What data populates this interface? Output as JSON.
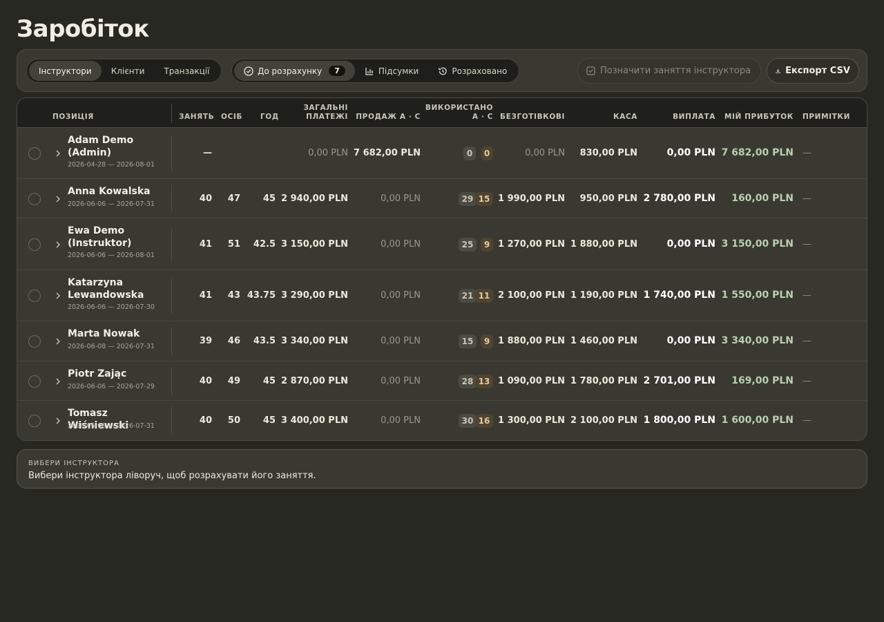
{
  "page_title": "Заробіток",
  "tabs_group1": [
    {
      "label": "Інструктори",
      "active": true
    },
    {
      "label": "Клієнти",
      "active": false
    },
    {
      "label": "Транзакції",
      "active": false
    }
  ],
  "tabs_group2": {
    "pending": {
      "label": "До розрахунку",
      "count": "7",
      "icon": "check-circle-icon"
    },
    "totals": {
      "label": "Підсумки",
      "icon": "bar-chart-icon"
    },
    "settled": {
      "label": "Розраховано",
      "icon": "history-icon"
    }
  },
  "actions": {
    "mark_label": "Позначити заняття інструктора",
    "export_label": "Експорт CSV"
  },
  "table": {
    "headers": {
      "position": "Позиція",
      "lessons": "Занять",
      "people": "Осіб",
      "hours": "Год",
      "total_payments_1": "Загальні",
      "total_payments_2": "платежі",
      "sales": "Продаж А · С",
      "used_1": "Використано",
      "used_2": "А · С",
      "cashless": "Безготівкові",
      "cash": "Каса",
      "payout": "Виплата",
      "profit": "Мій прибуток",
      "notes": "Примітки"
    },
    "rows": [
      {
        "name": "Adam Demo (Admin)",
        "dates": "2026-04-28 — 2026-08-01",
        "lessons": "—",
        "people": "",
        "hours": "",
        "payments": "0,00 PLN",
        "sales": "7 682,00 PLN",
        "used_a": "0",
        "used_c": "0",
        "cashless": "0,00 PLN",
        "cash": "830,00 PLN",
        "payout": "0,00 PLN",
        "profit": "7 682,00 PLN",
        "notes": "—"
      },
      {
        "name": "Anna Kowalska",
        "dates": "2026-06-06 — 2026-07-31",
        "lessons": "40",
        "people": "47",
        "hours": "45",
        "payments": "2 940,00 PLN",
        "sales": "0,00 PLN",
        "used_a": "29",
        "used_c": "15",
        "cashless": "1 990,00 PLN",
        "cash": "950,00 PLN",
        "payout": "2 780,00 PLN",
        "profit": "160,00 PLN",
        "notes": "—"
      },
      {
        "name": "Ewa Demo (Instruktor)",
        "dates": "2026-06-06 — 2026-08-01",
        "lessons": "41",
        "people": "51",
        "hours": "42.5",
        "payments": "3 150,00 PLN",
        "sales": "0,00 PLN",
        "used_a": "25",
        "used_c": "9",
        "cashless": "1 270,00 PLN",
        "cash": "1 880,00 PLN",
        "payout": "0,00 PLN",
        "profit": "3 150,00 PLN",
        "notes": "—"
      },
      {
        "name": "Katarzyna Lewandowska",
        "dates": "2026-06-06 — 2026-07-30",
        "lessons": "41",
        "people": "43",
        "hours": "43.75",
        "payments": "3 290,00 PLN",
        "sales": "0,00 PLN",
        "used_a": "21",
        "used_c": "11",
        "cashless": "2 100,00 PLN",
        "cash": "1 190,00 PLN",
        "payout": "1 740,00 PLN",
        "profit": "1 550,00 PLN",
        "notes": "—"
      },
      {
        "name": "Marta Nowak",
        "dates": "2026-06-08 — 2026-07-31",
        "lessons": "39",
        "people": "46",
        "hours": "43.5",
        "payments": "3 340,00 PLN",
        "sales": "0,00 PLN",
        "used_a": "15",
        "used_c": "9",
        "cashless": "1 880,00 PLN",
        "cash": "1 460,00 PLN",
        "payout": "0,00 PLN",
        "profit": "3 340,00 PLN",
        "notes": "—"
      },
      {
        "name": "Piotr Zając",
        "dates": "2026-06-06 — 2026-07-29",
        "lessons": "40",
        "people": "49",
        "hours": "45",
        "payments": "2 870,00 PLN",
        "sales": "0,00 PLN",
        "used_a": "28",
        "used_c": "13",
        "cashless": "1 090,00 PLN",
        "cash": "1 780,00 PLN",
        "payout": "2 701,00 PLN",
        "profit": "169,00 PLN",
        "notes": "—"
      },
      {
        "name": "Tomasz Wiśniewski",
        "dates": "2026-06-06 — 2026-07-31",
        "lessons": "40",
        "people": "50",
        "hours": "45",
        "payments": "3 400,00 PLN",
        "sales": "0,00 PLN",
        "used_a": "30",
        "used_c": "16",
        "cashless": "1 300,00 PLN",
        "cash": "2 100,00 PLN",
        "payout": "1 800,00 PLN",
        "profit": "1 600,00 PLN",
        "notes": "—"
      }
    ]
  },
  "hint": {
    "title": "ВИБЕРИ ІНСТРУКТОРА",
    "text": "Вибери інструктора ліворуч, щоб розрахувати його заняття."
  },
  "colors": {
    "background": "#282823",
    "card": "#3a3931",
    "profit_green": "#b9cfb0",
    "cash_pill": "#4e4430"
  }
}
